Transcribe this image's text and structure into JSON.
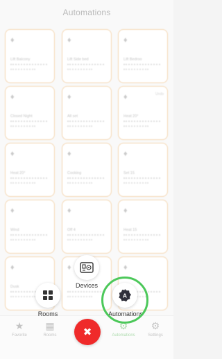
{
  "header": {
    "title": "Automations"
  },
  "tiles": [
    {
      "label": "Lift Balcony",
      "corner": ""
    },
    {
      "label": "Lift Side bed",
      "corner": ""
    },
    {
      "label": "Lift Bedroo",
      "corner": ""
    },
    {
      "label": "Closed Night",
      "corner": ""
    },
    {
      "label": "All set",
      "corner": ""
    },
    {
      "label": "Heat 20°",
      "corner": "Undo"
    },
    {
      "label": "Heat 20°",
      "corner": ""
    },
    {
      "label": "Cooking",
      "corner": ""
    },
    {
      "label": "Set 15",
      "corner": ""
    },
    {
      "label": "Wind",
      "corner": ""
    },
    {
      "label": "Off 4",
      "corner": ""
    },
    {
      "label": "Heat 15",
      "corner": ""
    },
    {
      "label": "Dusk",
      "corner": ""
    },
    {
      "label": "",
      "corner": ""
    },
    {
      "label": "",
      "corner": ""
    }
  ],
  "tab_bar": {
    "items": [
      {
        "label": "Favorite",
        "icon": "star"
      },
      {
        "label": "Rooms",
        "icon": "grid"
      },
      {
        "label": "Automations",
        "icon": "automation"
      },
      {
        "label": "Settings",
        "icon": "gear"
      }
    ]
  },
  "fab_menu": {
    "devices_label": "Devices",
    "rooms_label": "Rooms",
    "automations_label": "Automations",
    "close_icon": "✖",
    "accent_color": "#ef2a2a",
    "highlight_color": "#4cc85a"
  }
}
